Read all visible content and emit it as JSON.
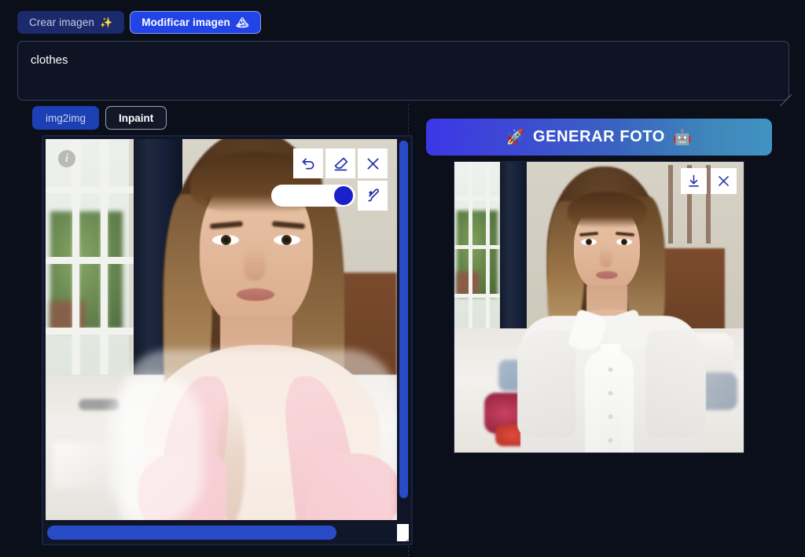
{
  "app": {
    "background_color": "#0b0f1a",
    "accent_blue": "#2143e8"
  },
  "top_tabs": [
    {
      "label": "Crear imagen",
      "emoji": "✨",
      "state": "inactive",
      "name": "tab-crear-imagen"
    },
    {
      "label": "Modificar imagen",
      "emoji": "🏔",
      "state": "active",
      "name": "tab-modificar-imagen"
    }
  ],
  "prompt": {
    "value": "clothes",
    "placeholder": "clothes"
  },
  "left_panel": {
    "mode_tabs": [
      {
        "label": "img2img",
        "state": "filled"
      },
      {
        "label": "Inpaint",
        "state": "outlined-active"
      }
    ],
    "info_glyph": "i",
    "canvas_tools": [
      {
        "name": "undo-icon",
        "label": "Deshacer"
      },
      {
        "name": "eraser-icon",
        "label": "Borrar"
      },
      {
        "name": "close-icon",
        "label": "Cerrar"
      }
    ],
    "brush": {
      "slider_value": "100",
      "knob_color": "#1a21c9",
      "tool_name": "brush-icon"
    },
    "scrollbars": {
      "vertical_thumb_pct": "94",
      "horizontal_thumb_pct": "82",
      "color": "#2a4bc7"
    }
  },
  "right_panel": {
    "generate_button": {
      "prefix_emoji": "🚀",
      "label": "GENERAR FOTO",
      "suffix_emoji": "🤖",
      "gradient_from": "#3b37e6",
      "gradient_to": "#4193c4"
    },
    "result_tools": [
      {
        "name": "download-icon",
        "label": "Descargar"
      },
      {
        "name": "close-icon",
        "label": "Cerrar"
      }
    ]
  }
}
